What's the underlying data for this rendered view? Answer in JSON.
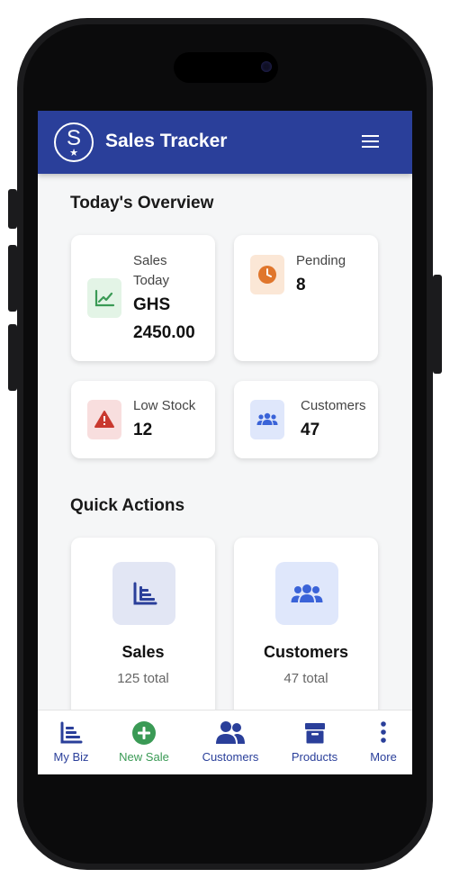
{
  "app": {
    "title": "Sales Tracker",
    "logo_letter": "S",
    "logo_star": "★"
  },
  "overview": {
    "heading": "Today's Overview",
    "cards": [
      {
        "label": "Sales Today",
        "value_line1": "GHS",
        "value_line2": "2450.00",
        "icon": "chart-line-icon",
        "color": "#3a9a55"
      },
      {
        "label": "Pending",
        "value": "8",
        "icon": "clock-icon",
        "color": "#e0762c"
      },
      {
        "label": "Low Stock",
        "value": "12",
        "icon": "warning-icon",
        "color": "#c9392f"
      },
      {
        "label": "Customers",
        "value": "47",
        "icon": "users-icon",
        "color": "#3a63d8"
      }
    ]
  },
  "quick_actions": {
    "heading": "Quick Actions",
    "items": [
      {
        "label": "Sales",
        "sub": "125 total",
        "icon": "sales-list-icon"
      },
      {
        "label": "Customers",
        "sub": "47 total",
        "icon": "users-icon"
      }
    ]
  },
  "bottom_nav": {
    "items": [
      {
        "label": "My Biz",
        "icon": "bar-list-icon",
        "color": "#2a3f9a"
      },
      {
        "label": "New Sale",
        "icon": "plus-circle-icon",
        "color": "#3a9a55"
      },
      {
        "label": "Customers",
        "icon": "users-icon",
        "color": "#2a3f9a"
      },
      {
        "label": "Products",
        "icon": "box-icon",
        "color": "#2a3f9a"
      },
      {
        "label": "More",
        "icon": "more-vertical-icon",
        "color": "#2a3f9a"
      }
    ]
  }
}
